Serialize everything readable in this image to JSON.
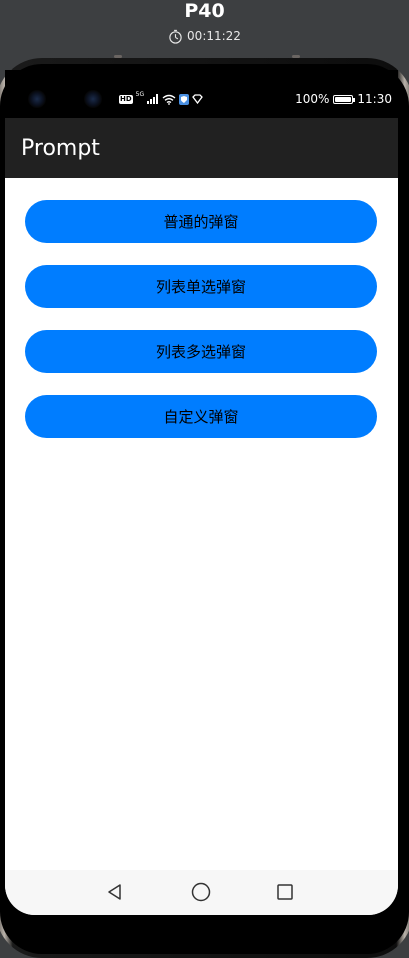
{
  "device": {
    "name": "P40",
    "elapsed": "00:11:22"
  },
  "status_bar": {
    "left_badge": "HD",
    "signal_label": "5G",
    "battery_percent": "100%",
    "battery_level": 1.0,
    "time": "11:30"
  },
  "app": {
    "title": "Prompt"
  },
  "buttons": [
    {
      "label": "普通的弹窗"
    },
    {
      "label": "列表单选弹窗"
    },
    {
      "label": "列表多选弹窗"
    },
    {
      "label": "自定义弹窗"
    }
  ],
  "colors": {
    "button_bg": "#007dff",
    "appbar_bg": "#212121",
    "statusbar_bg": "#000000",
    "navbar_bg": "#f7f7f7"
  },
  "icons": {
    "timer": "stopwatch-icon",
    "back": "back-triangle-icon",
    "home": "home-circle-icon",
    "recents": "recents-square-icon"
  }
}
